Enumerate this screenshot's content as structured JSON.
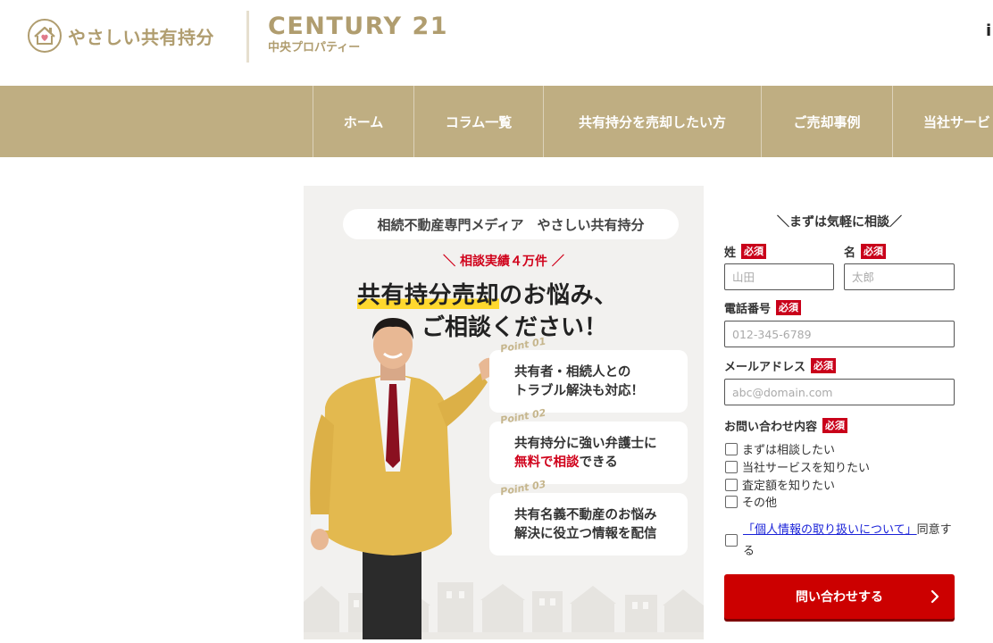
{
  "header": {
    "site_name": "やさしい共有持分",
    "brand_title": "CENTURY 21",
    "brand_subtitle": "中央プロパティー",
    "edge_glyph": "i"
  },
  "nav": {
    "items": [
      "ホーム",
      "コラム一覧",
      "共有持分を売却したい方",
      "ご売却事例",
      "当社サービ"
    ]
  },
  "banner": {
    "pill": "相続不動産専門メディア　やさしい共有持分",
    "consult": "＼ 相談実績４万件 ／",
    "headline_mark": "共有持分売却",
    "headline_rest": "のお悩み、",
    "headline2": "ご相談ください！",
    "points": [
      {
        "label": "Point 01",
        "line1": "共有者・相続人との",
        "line2": "トラブル解決も対応！",
        "line2_red": "",
        "line2_tail": ""
      },
      {
        "label": "Point 02",
        "line1": "共有持分に強い弁護士に",
        "line2": "",
        "line2_red": "無料で相談",
        "line2_tail": "できる"
      },
      {
        "label": "Point 03",
        "line1": "共有名義不動産のお悩み",
        "line2": "解決に役立つ情報を配信",
        "line2_red": "",
        "line2_tail": ""
      }
    ]
  },
  "form": {
    "title": "＼まずは気軽に相談／",
    "required_badge": "必須",
    "last_name_label": "姓",
    "last_name_placeholder": "山田",
    "first_name_label": "名",
    "first_name_placeholder": "太郎",
    "phone_label": "電話番号",
    "phone_placeholder": "012-345-6789",
    "email_label": "メールアドレス",
    "email_placeholder": "abc@domain.com",
    "inquiry_label": "お問い合わせ内容",
    "inquiry_options": [
      "まずは相談したい",
      "当社サービスを知りたい",
      "査定額を知りたい",
      "その他"
    ],
    "privacy_link": "「個人情報の取り扱いについて」",
    "privacy_tail": "同意する",
    "submit_label": "問い合わせする"
  },
  "colors": {
    "gold": "#b09d6f",
    "nav_bg": "#bfae82",
    "banner_bg": "#f2f1ef",
    "red": "#cc0000"
  }
}
